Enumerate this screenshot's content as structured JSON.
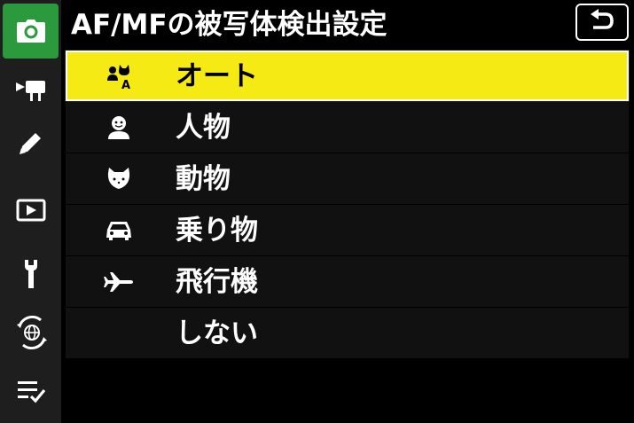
{
  "header": {
    "title": "AF/MFの被写体検出設定",
    "back_icon": "return-arrow-icon"
  },
  "sidebar": {
    "tabs": [
      {
        "name": "photo-shooting",
        "icon": "camera-icon",
        "active": true
      },
      {
        "name": "movie-recording",
        "icon": "movie-camera-icon",
        "active": false
      },
      {
        "name": "custom-settings",
        "icon": "pencil-icon",
        "active": false
      },
      {
        "name": "playback",
        "icon": "playback-icon",
        "active": false
      },
      {
        "name": "setup",
        "icon": "wrench-icon",
        "active": false
      },
      {
        "name": "network",
        "icon": "network-globe-icon",
        "active": false
      },
      {
        "name": "my-menu",
        "icon": "checklist-icon",
        "active": false
      }
    ]
  },
  "menu": {
    "items": [
      {
        "label": "オート",
        "icon": "auto-subject-icon",
        "selected": true
      },
      {
        "label": "人物",
        "icon": "person-icon",
        "selected": false
      },
      {
        "label": "動物",
        "icon": "animal-icon",
        "selected": false
      },
      {
        "label": "乗り物",
        "icon": "car-icon",
        "selected": false
      },
      {
        "label": "飛行機",
        "icon": "airplane-icon",
        "selected": false
      },
      {
        "label": "しない",
        "icon": "",
        "selected": false
      }
    ]
  },
  "colors": {
    "accent_active_tab": "#2a9a3c",
    "selected_row": "#f5ea13",
    "sidebar_bg": "#1e1e1e",
    "row_bg": "#111111"
  }
}
